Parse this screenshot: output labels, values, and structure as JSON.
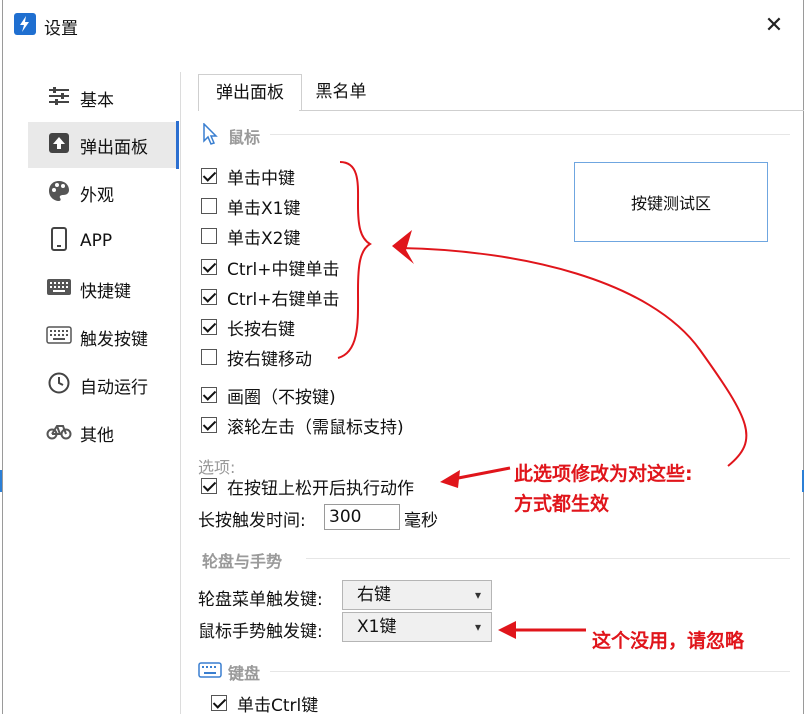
{
  "window": {
    "title": "设置",
    "close_icon": "close-icon"
  },
  "sidebar": {
    "items": [
      {
        "label": "基本",
        "icon": "sliders-icon"
      },
      {
        "label": "弹出面板",
        "icon": "upload-icon"
      },
      {
        "label": "外观",
        "icon": "palette-icon"
      },
      {
        "label": "APP",
        "icon": "phone-icon"
      },
      {
        "label": "快捷键",
        "icon": "keyboard-icon"
      },
      {
        "label": "触发按键",
        "icon": "keyboard-outline-icon"
      },
      {
        "label": "自动运行",
        "icon": "clock-icon"
      },
      {
        "label": "其他",
        "icon": "bicycle-icon"
      }
    ],
    "active_index": 1
  },
  "tabs": [
    {
      "label": "弹出面板"
    },
    {
      "label": "黑名单"
    }
  ],
  "mouse_section": {
    "title": "鼠标",
    "options": [
      {
        "label": "单击中键",
        "checked": true
      },
      {
        "label": "单击X1键",
        "checked": false
      },
      {
        "label": "单击X2键",
        "checked": false
      },
      {
        "label": "Ctrl+中键单击",
        "checked": true
      },
      {
        "label": "Ctrl+右键单击",
        "checked": true
      },
      {
        "label": "长按右键",
        "checked": true
      },
      {
        "label": "按右键移动",
        "checked": false
      },
      {
        "label": "画圈（不按键)",
        "checked": true
      },
      {
        "label": "滚轮左击（需鼠标支持)",
        "checked": true
      }
    ],
    "test_area_label": "按键测试区"
  },
  "options_section": {
    "title": "选项:",
    "release_option": {
      "label": "在按钮上松开后执行动作",
      "checked": true
    },
    "long_press_label": "长按触发时间:",
    "long_press_value": "300",
    "long_press_unit": "毫秒"
  },
  "wheel_section": {
    "title": "轮盘与手势",
    "menu_trigger_label": "轮盘菜单触发键:",
    "menu_trigger_value": "右键",
    "gesture_trigger_label": "鼠标手势触发键:",
    "gesture_trigger_value": "X1键"
  },
  "keyboard_section": {
    "title": "键盘",
    "options": [
      {
        "label": "单击Ctrl键",
        "checked": true
      }
    ]
  },
  "annotations": {
    "note1_line1": "此选项修改为对这些:",
    "note1_line2": "方式都生效",
    "note2": "这个没用，请忽略"
  },
  "colors": {
    "accent": "#2b6fd0",
    "annotation": "#e0151b"
  }
}
